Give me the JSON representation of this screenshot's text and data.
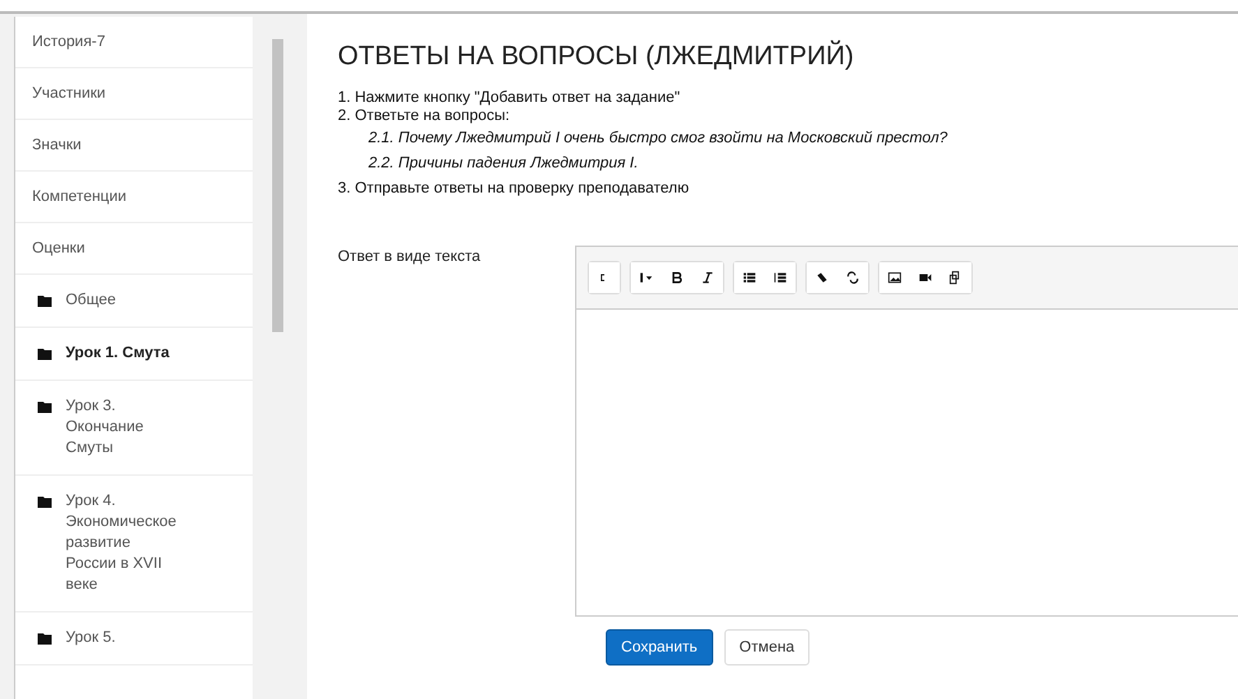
{
  "sidebar": {
    "items": [
      {
        "kind": "link",
        "label": "История-7",
        "selected": false
      },
      {
        "kind": "link",
        "label": "Участники",
        "selected": false
      },
      {
        "kind": "link",
        "label": "Значки",
        "selected": false
      },
      {
        "kind": "link",
        "label": "Компетенции",
        "selected": false
      },
      {
        "kind": "link",
        "label": "Оценки",
        "selected": false
      },
      {
        "kind": "folder",
        "label": "Общее",
        "selected": false
      },
      {
        "kind": "folder",
        "label": "Урок 1. Смута",
        "selected": true
      },
      {
        "kind": "folder",
        "label": "Урок 3. Окончание Смуты",
        "selected": false
      },
      {
        "kind": "folder",
        "label": "Урок 4. Экономическое развитие России в XVII веке",
        "selected": false
      },
      {
        "kind": "folder",
        "label": "Урок 5.",
        "selected": false
      }
    ]
  },
  "title": "ОТВЕТЫ НА ВОПРОСЫ (ЛЖЕДМИТРИЙ)",
  "instructions": [
    {
      "kind": "step",
      "text": "1. Нажмите кнопку \"Добавить ответ на задание\""
    },
    {
      "kind": "step",
      "text": "2. Ответьте на вопросы:"
    },
    {
      "kind": "question",
      "text": "2.1. Почему Лжедмитрий I очень быстро смог взойти на Московский престол?"
    },
    {
      "kind": "question",
      "text": "2.2. Причины падения Лжедмитрия I."
    },
    {
      "kind": "step",
      "text": "3. Отправьте ответы на проверку преподавателю"
    }
  ],
  "field_label": "Ответ в виде текста",
  "toolbar": [
    {
      "buttons": [
        {
          "kind": "more"
        }
      ]
    },
    {
      "buttons": [
        {
          "kind": "heading"
        },
        {
          "kind": "bold"
        },
        {
          "kind": "italic"
        }
      ]
    },
    {
      "buttons": [
        {
          "kind": "bullets"
        },
        {
          "kind": "numbers"
        }
      ]
    },
    {
      "buttons": [
        {
          "kind": "link"
        },
        {
          "kind": "unlink"
        }
      ]
    },
    {
      "buttons": [
        {
          "kind": "image"
        },
        {
          "kind": "video"
        },
        {
          "kind": "files"
        }
      ]
    }
  ],
  "buttons": [
    {
      "kind": "primary",
      "label": "Сохранить"
    },
    {
      "kind": "secondary",
      "label": "Отмена"
    }
  ]
}
